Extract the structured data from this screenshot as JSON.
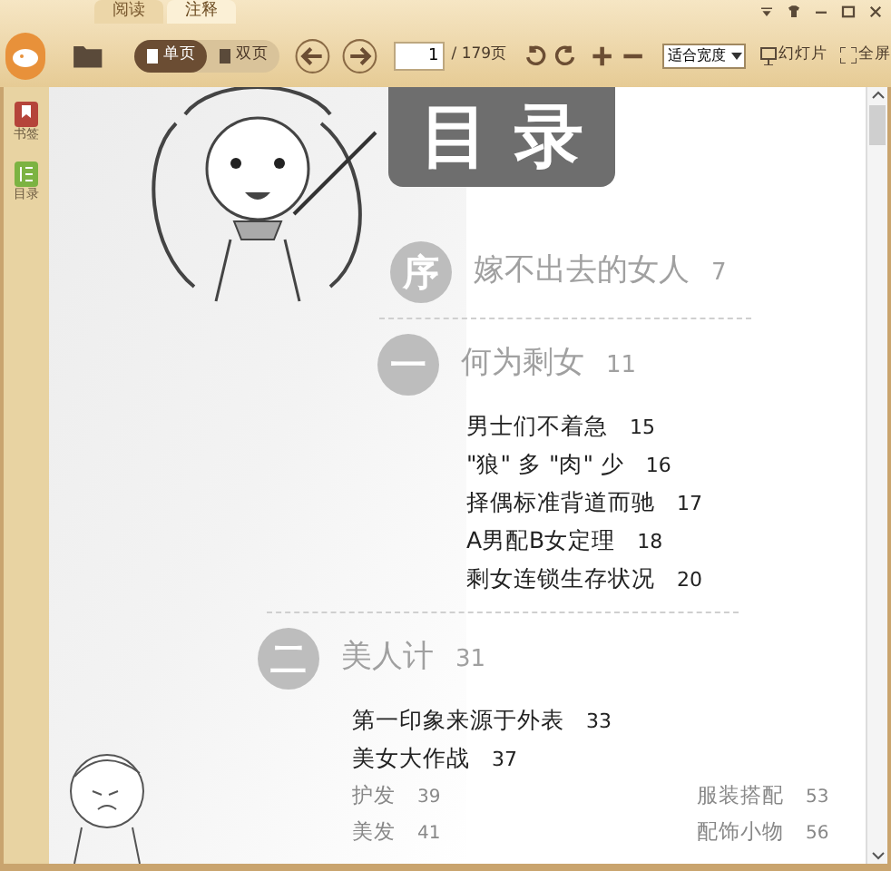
{
  "tabs": [
    {
      "label": "阅读",
      "selected": false
    },
    {
      "label": "注释",
      "selected": true
    }
  ],
  "toolbar": {
    "view_modes": [
      {
        "label": "单页",
        "selected": true
      },
      {
        "label": "双页",
        "selected": false
      }
    ],
    "page_input": "1",
    "page_total": "/ 179页",
    "zoom_select": "适合宽度",
    "slideshow": "幻灯片",
    "fullscreen": "全屏"
  },
  "sidebar": {
    "items": [
      {
        "label": "书签",
        "kind": "bookmark"
      },
      {
        "label": "目录",
        "kind": "contents"
      }
    ]
  },
  "page": {
    "title": "目录",
    "sections": [
      {
        "badge": "序",
        "title": "嫁不出去的女人",
        "page": "7"
      },
      {
        "badge": "一",
        "title": "何为剩女",
        "page": "11",
        "items": [
          {
            "title": "男士们不着急",
            "page": "15"
          },
          {
            "title": "\"狼\" 多 \"肉\" 少",
            "page": "16"
          },
          {
            "title": "择偶标准背道而驰",
            "page": "17"
          },
          {
            "title": "A男配B女定理",
            "page": "18"
          },
          {
            "title": "剩女连锁生存状况",
            "page": "20"
          }
        ]
      },
      {
        "badge": "二",
        "title": "美人计",
        "page": "31",
        "items": [
          {
            "title": "第一印象来源于外表",
            "page": "33"
          },
          {
            "title": "美女大作战",
            "page": "37"
          }
        ],
        "columns": [
          [
            {
              "title": "护发",
              "page": "39"
            },
            {
              "title": "美发",
              "page": "41"
            }
          ],
          [
            {
              "title": "服装搭配",
              "page": "53"
            },
            {
              "title": "配饰小物",
              "page": "56"
            }
          ]
        ]
      }
    ]
  }
}
